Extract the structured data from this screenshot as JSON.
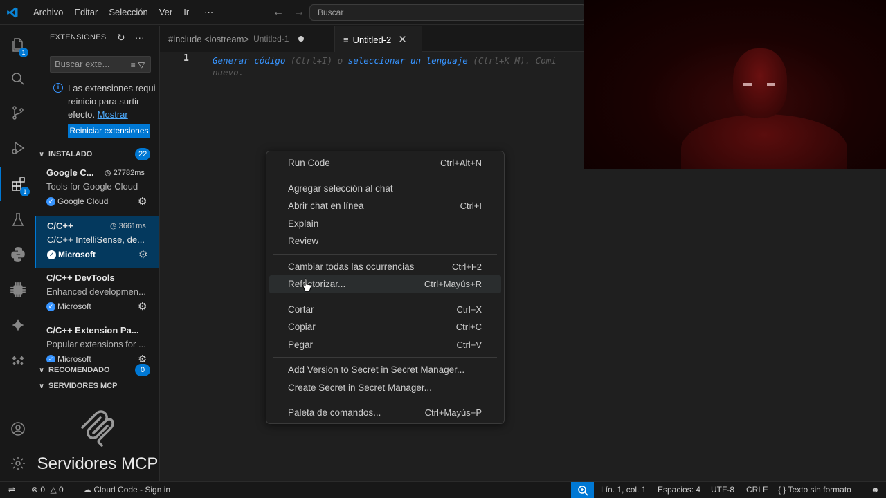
{
  "titlebar": {
    "menus": [
      "Archivo",
      "Editar",
      "Selección",
      "Ver",
      "Ir"
    ],
    "more": "···",
    "search_placeholder": "Buscar"
  },
  "activity": {
    "explorer_badge": "1",
    "extensions_badge": "1"
  },
  "sidebar": {
    "title": "EXTENSIONES",
    "search_placeholder": "Buscar exte...",
    "notice": {
      "line1": "Las extensiones requi",
      "line2": "reinicio para surtir",
      "line3": "efecto.",
      "link": "Mostrar"
    },
    "restart_button": "Reiniciar extensiones",
    "installed_label": "INSTALADO",
    "installed_count": "22",
    "extensions": [
      {
        "name": "Google C...",
        "time": "27782ms",
        "desc": "Tools for Google Cloud",
        "publisher": "Google Cloud"
      },
      {
        "name": "C/C++",
        "time": "3661ms",
        "desc": "C/C++ IntelliSense, de...",
        "publisher": "Microsoft"
      },
      {
        "name": "C/C++ DevTools",
        "time": "",
        "desc": "Enhanced developmen...",
        "publisher": "Microsoft"
      },
      {
        "name": "C/C++ Extension Pa...",
        "time": "",
        "desc": "Popular extensions for ...",
        "publisher": "Microsoft"
      }
    ],
    "recommended_label": "RECOMENDADO",
    "recommended_count": "0",
    "mcp_label": "SERVIDORES MCP",
    "mcp_title": "Servidores MCP"
  },
  "editor": {
    "tabs": [
      {
        "label": "#include <iostream>",
        "sub": "Untitled-1"
      },
      {
        "label": "Untitled-2"
      }
    ],
    "line_number": "1",
    "hint": {
      "p1": "Generar código",
      "p2": " (Ctrl+I) o ",
      "p3": "seleccionar un lenguaje",
      "p4": " (Ctrl+K M). Comi",
      "line2": "nuevo."
    }
  },
  "context_menu": {
    "groups": [
      [
        {
          "label": "Run Code",
          "key": "Ctrl+Alt+N"
        }
      ],
      [
        {
          "label": "Agregar selección al chat",
          "key": ""
        },
        {
          "label": "Abrir chat en línea",
          "key": "Ctrl+I"
        },
        {
          "label": "Explain",
          "key": ""
        },
        {
          "label": "Review",
          "key": ""
        }
      ],
      [
        {
          "label": "Cambiar todas las ocurrencias",
          "key": "Ctrl+F2"
        },
        {
          "label": "Refactorizar...",
          "key": "Ctrl+Mayús+R"
        }
      ],
      [
        {
          "label": "Cortar",
          "key": "Ctrl+X"
        },
        {
          "label": "Copiar",
          "key": "Ctrl+C"
        },
        {
          "label": "Pegar",
          "key": "Ctrl+V"
        }
      ],
      [
        {
          "label": "Add Version to Secret in Secret Manager...",
          "key": ""
        },
        {
          "label": "Create Secret in Secret Manager...",
          "key": ""
        }
      ],
      [
        {
          "label": "Paleta de comandos...",
          "key": "Ctrl+Mayús+P"
        }
      ]
    ]
  },
  "statusbar": {
    "errors": "0",
    "warnings": "0",
    "cloud": "Cloud Code - Sign in",
    "position": "Lín. 1, col. 1",
    "spaces": "Espacios: 4",
    "encoding": "UTF-8",
    "eol": "CRLF",
    "language": "Texto sin formato"
  },
  "colors": {
    "accent": "#0078d4",
    "link": "#4daafc"
  }
}
